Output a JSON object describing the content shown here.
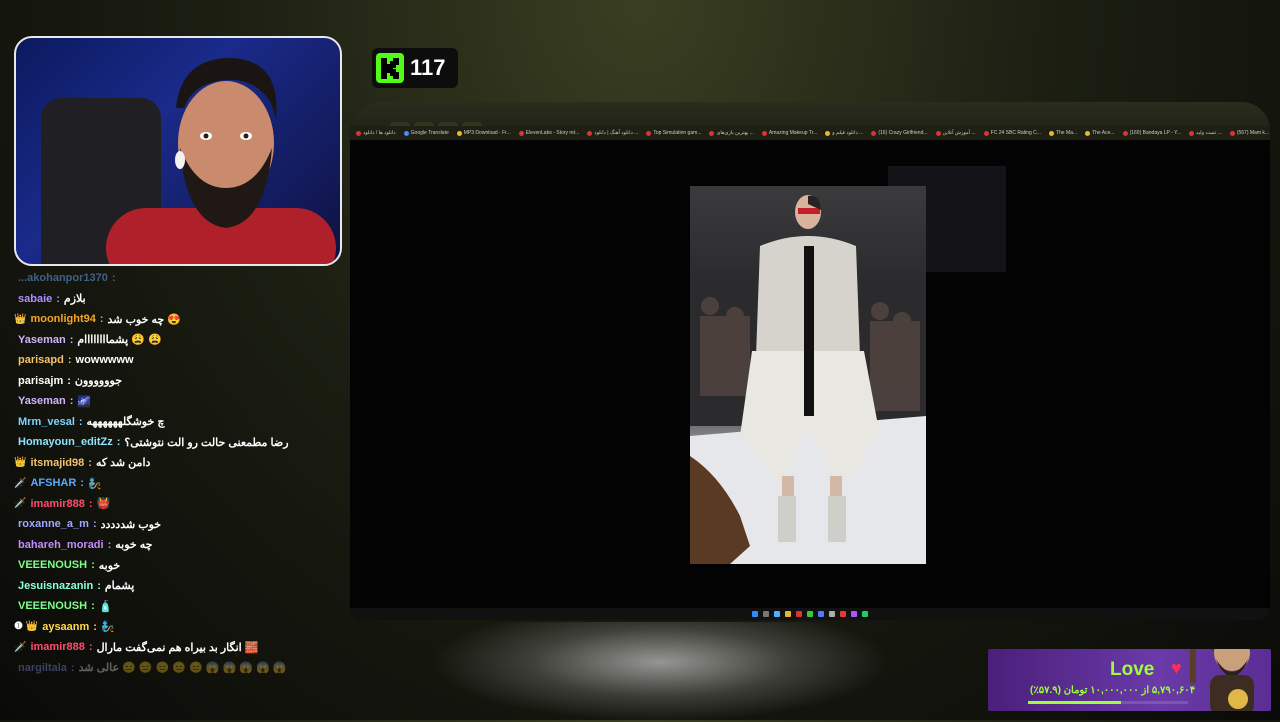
{
  "viewers": {
    "count": "117"
  },
  "browser": {
    "tabs": [
      "",
      "",
      "",
      ""
    ],
    "bookmarks": [
      "دانلود ها / دانلود",
      "Google Translate",
      "MP3 Download - Fr...",
      "ElevenLabs - Story ret...",
      "دانلود آهنگ | دانلود ...",
      "Top Simulation gam...",
      "بهترین بازی‌های ...",
      "Amazing Makeup Tr...",
      "دانلود فیلم و ...",
      "(16) Crazy Girlfriend...",
      "آموزش آنلاین ...",
      "FC 24 SBC Rating C...",
      "The Ma...",
      "The Ace...",
      "(160) Bandaya LP - Y...",
      "تست ولید ...",
      "(567) Mam k..."
    ]
  },
  "chat": [
    {
      "user": "...akohanpor1370",
      "text": "",
      "color": "#6ea8ff",
      "badge": "",
      "cls": "cut"
    },
    {
      "user": "sabaie",
      "text": "بلازم",
      "color": "#b18cff",
      "badge": ""
    },
    {
      "user": "moonlight94",
      "text": "چه خوب شد 😍",
      "color": "#f5a623",
      "badge": "👑"
    },
    {
      "user": "Yaseman",
      "text": "پشماااااااام 😩 😩",
      "color": "#d0b3ff",
      "badge": ""
    },
    {
      "user": "parisapd",
      "text": "wowwwww",
      "color": "#f5c26b",
      "badge": ""
    },
    {
      "user": "parisajm",
      "text": "جوووووون",
      "color": "#ffffff",
      "badge": ""
    },
    {
      "user": "Yaseman",
      "text": "🌌",
      "color": "#d0b3ff",
      "badge": ""
    },
    {
      "user": "Mrm_vesal",
      "text": "چ خوشگلههههههه",
      "color": "#7fd3ff",
      "badge": ""
    },
    {
      "user": "Homayoun_editZz",
      "text": "رضا مطمعنی حالت رو الت نتوشتی؟",
      "color": "#8fe3ff",
      "badge": ""
    },
    {
      "user": "itsmajid98",
      "text": "دامن شد که",
      "color": "#f5c26b",
      "badge": "👑"
    },
    {
      "user": "AFSHAR",
      "text": "🧞",
      "color": "#5aa9ff",
      "badge": "🗡️"
    },
    {
      "user": "imamir888",
      "text": "👹",
      "color": "#ff4d6d",
      "badge": "🗡️"
    },
    {
      "user": "roxanne_a_m",
      "text": "خوب شددددد",
      "color": "#9fa8ff",
      "badge": ""
    },
    {
      "user": "bahareh_moradi",
      "text": "چه خوبه",
      "color": "#c48bff",
      "badge": ""
    },
    {
      "user": "VEEENOUSH",
      "text": "خوبه",
      "color": "#7dff8a",
      "badge": ""
    },
    {
      "user": "Jesuisnazanin",
      "text": "پشمام",
      "color": "#8cffd9",
      "badge": ""
    },
    {
      "user": "VEEENOUSH",
      "text": "🧴",
      "color": "#7dff8a",
      "badge": ""
    },
    {
      "user": "aysaanm",
      "text": "🧞",
      "color": "#ffd94a",
      "badge": "❶ 👑"
    },
    {
      "user": "imamir888",
      "text": "انگار بد بیراه هم نمی‌گفت مارال 🧱",
      "color": "#ff4d6d",
      "badge": "🗡️"
    },
    {
      "user": "nargiltala",
      "text": "عالی شد 😑 😑 😑 😑 😑 😱 😱 😱 😱 😱",
      "color": "#9aa0ff",
      "badge": "",
      "cls": "faded"
    }
  ],
  "goal": {
    "title": "Love",
    "progress_text": "۵,۷۹۰,۶۰۴ از ۱۰,۰۰۰,۰۰۰ تومان (۵۷.۹٪)",
    "progress_fraction": 0.579
  },
  "colors": {
    "kick_green": "#53fc18",
    "goal_green": "#9cff3a",
    "goal_purple": "#6a3aa8"
  }
}
